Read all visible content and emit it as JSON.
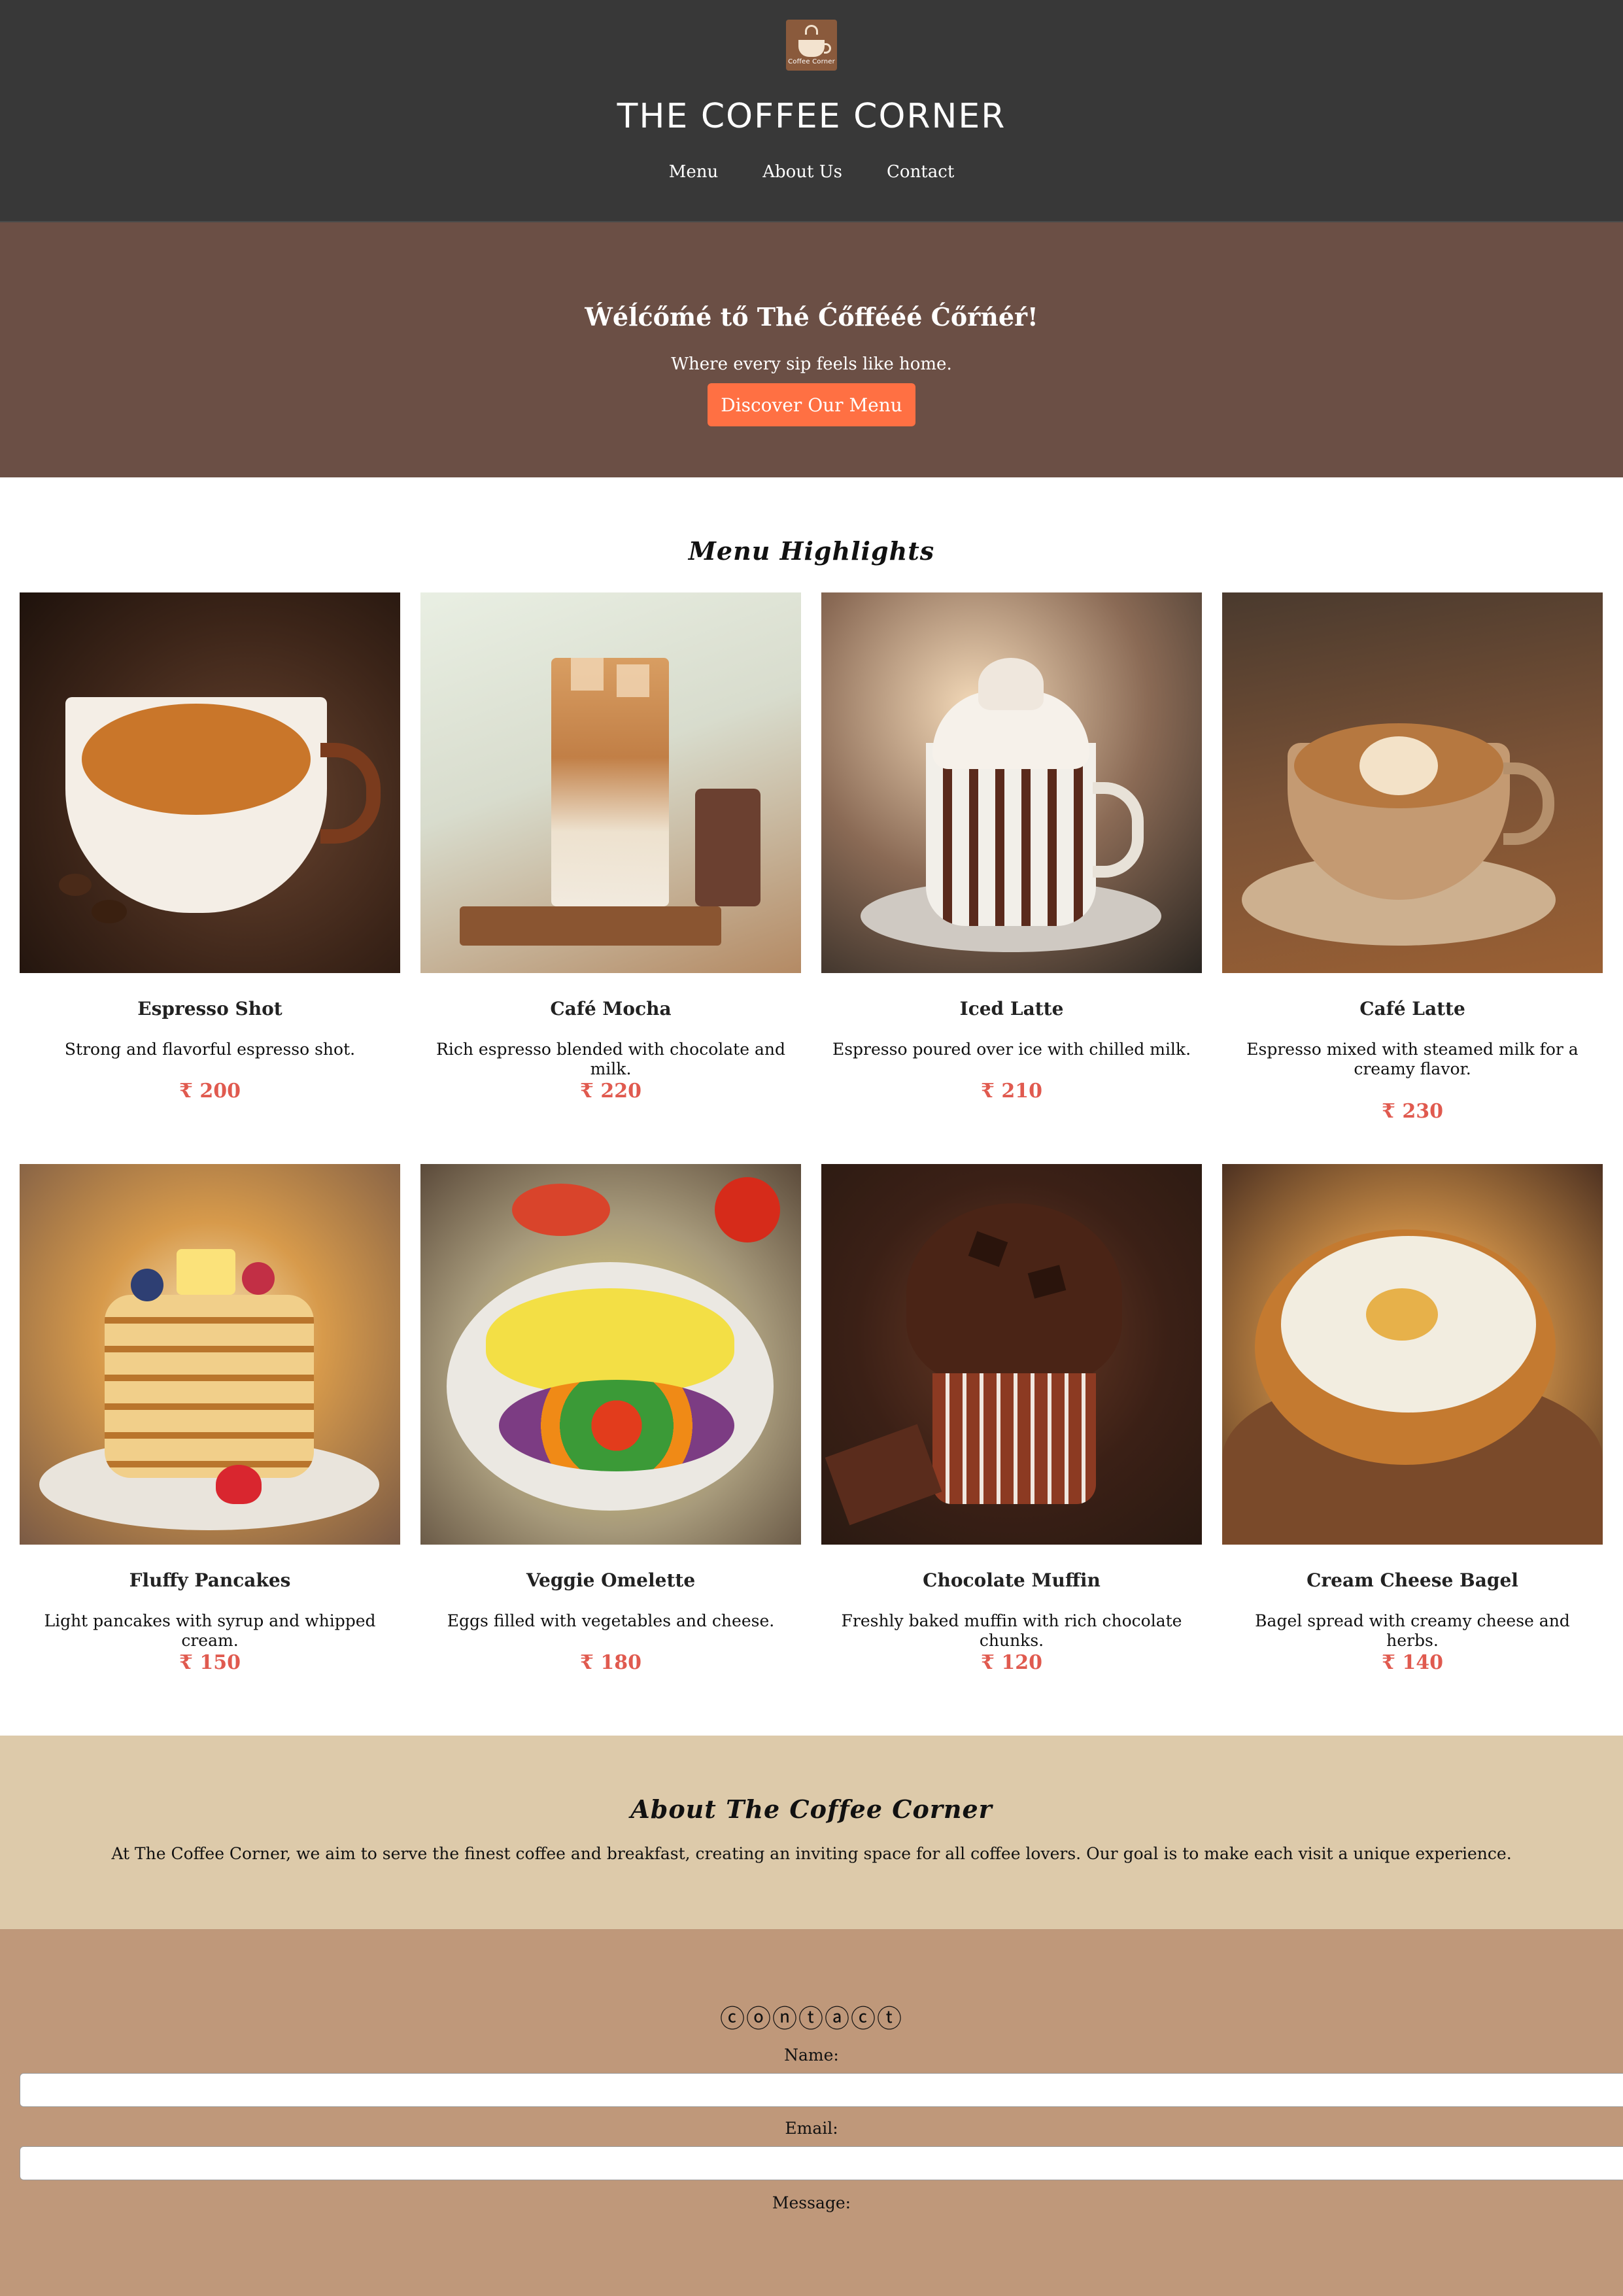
{
  "header": {
    "logo_text": "Coffee Corner",
    "title": "THE COFFEE CORNER",
    "nav": [
      "Menu",
      "About Us",
      "Contact"
    ]
  },
  "hero": {
    "heading": "Ẃéĺćőḿé tő Thé Ćőffééé Ćőŕńéŕ!",
    "tagline": "Where every sip feels like home.",
    "cta_label": "Discover Our Menu",
    "cta_color": "#ff7043"
  },
  "menu": {
    "title": "Menu Highlights",
    "items": [
      {
        "name": "Espresso Shot",
        "description": "Strong and flavorful espresso shot.",
        "price": "₹ 200",
        "image": "espresso-cup-photo"
      },
      {
        "name": "Café Mocha",
        "description": "Rich espresso blended with chocolate and milk.",
        "price": "₹ 220",
        "image": "iced-mocha-glass-photo"
      },
      {
        "name": "Iced Latte",
        "description": "Espresso poured over ice with chilled milk.",
        "price": "₹ 210",
        "image": "whipped-cream-mug-photo"
      },
      {
        "name": "Café Latte",
        "description": "Espresso mixed with steamed milk for a creamy flavor.",
        "price": "₹ 230",
        "image": "latte-art-cup-photo"
      },
      {
        "name": "Fluffy Pancakes",
        "description": "Light pancakes with syrup and whipped cream.",
        "price": "₹ 150",
        "image": "pancake-stack-photo"
      },
      {
        "name": "Veggie Omelette",
        "description": "Eggs filled with vegetables and cheese.",
        "price": "₹ 180",
        "image": "omelette-plate-photo"
      },
      {
        "name": "Chocolate Muffin",
        "description": "Freshly baked muffin with rich chocolate chunks.",
        "price": "₹ 120",
        "image": "chocolate-muffin-photo"
      },
      {
        "name": "Cream Cheese Bagel",
        "description": "Bagel spread with creamy cheese and herbs.",
        "price": "₹ 140",
        "image": "cream-cheese-bagel-photo"
      }
    ],
    "price_color": "#e05a4f"
  },
  "about": {
    "title": "About The Coffee Corner",
    "text": "At The Coffee Corner, we aim to serve the finest coffee and breakfast, creating an inviting space for all coffee lovers. Our goal is to make each visit a unique experience."
  },
  "contact": {
    "title": "ⓒⓞⓝⓣⓐⓒⓣ",
    "name_label": "Name:",
    "email_label": "Email:",
    "message_label": "Message:",
    "name_value": "",
    "email_value": ""
  },
  "colors": {
    "header_bg": "#383838",
    "hero_bg": "#6b4f45",
    "about_bg": "#ddcaaa",
    "contact_bg": "#bf987a"
  }
}
